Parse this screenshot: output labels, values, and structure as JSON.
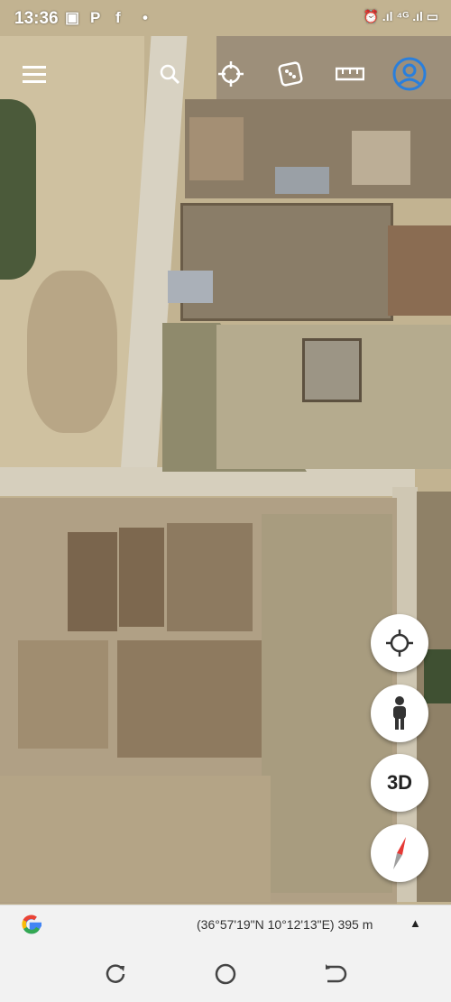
{
  "status_bar": {
    "time": "13:36",
    "app_icons": [
      "P",
      "f",
      "•"
    ],
    "indicators": "⏰ .ıl ⁴ᴳ .ıl ▭"
  },
  "toolbar": {
    "icons": [
      "menu-icon",
      "search-icon",
      "voyager-icon",
      "dice-icon",
      "ruler-icon",
      "account-icon"
    ]
  },
  "map_controls": {
    "three_d_label": "3D"
  },
  "info_bar": {
    "coordinates": "(36°57'19\"N 10°12'13\"E) 395 m",
    "logo": "G",
    "caret": "▲"
  },
  "nav_bar": {
    "icons": [
      "recents-icon",
      "home-icon",
      "back-icon"
    ]
  },
  "colors": {
    "accent_blue": "#2a7fdc",
    "compass_red": "#e53935"
  }
}
